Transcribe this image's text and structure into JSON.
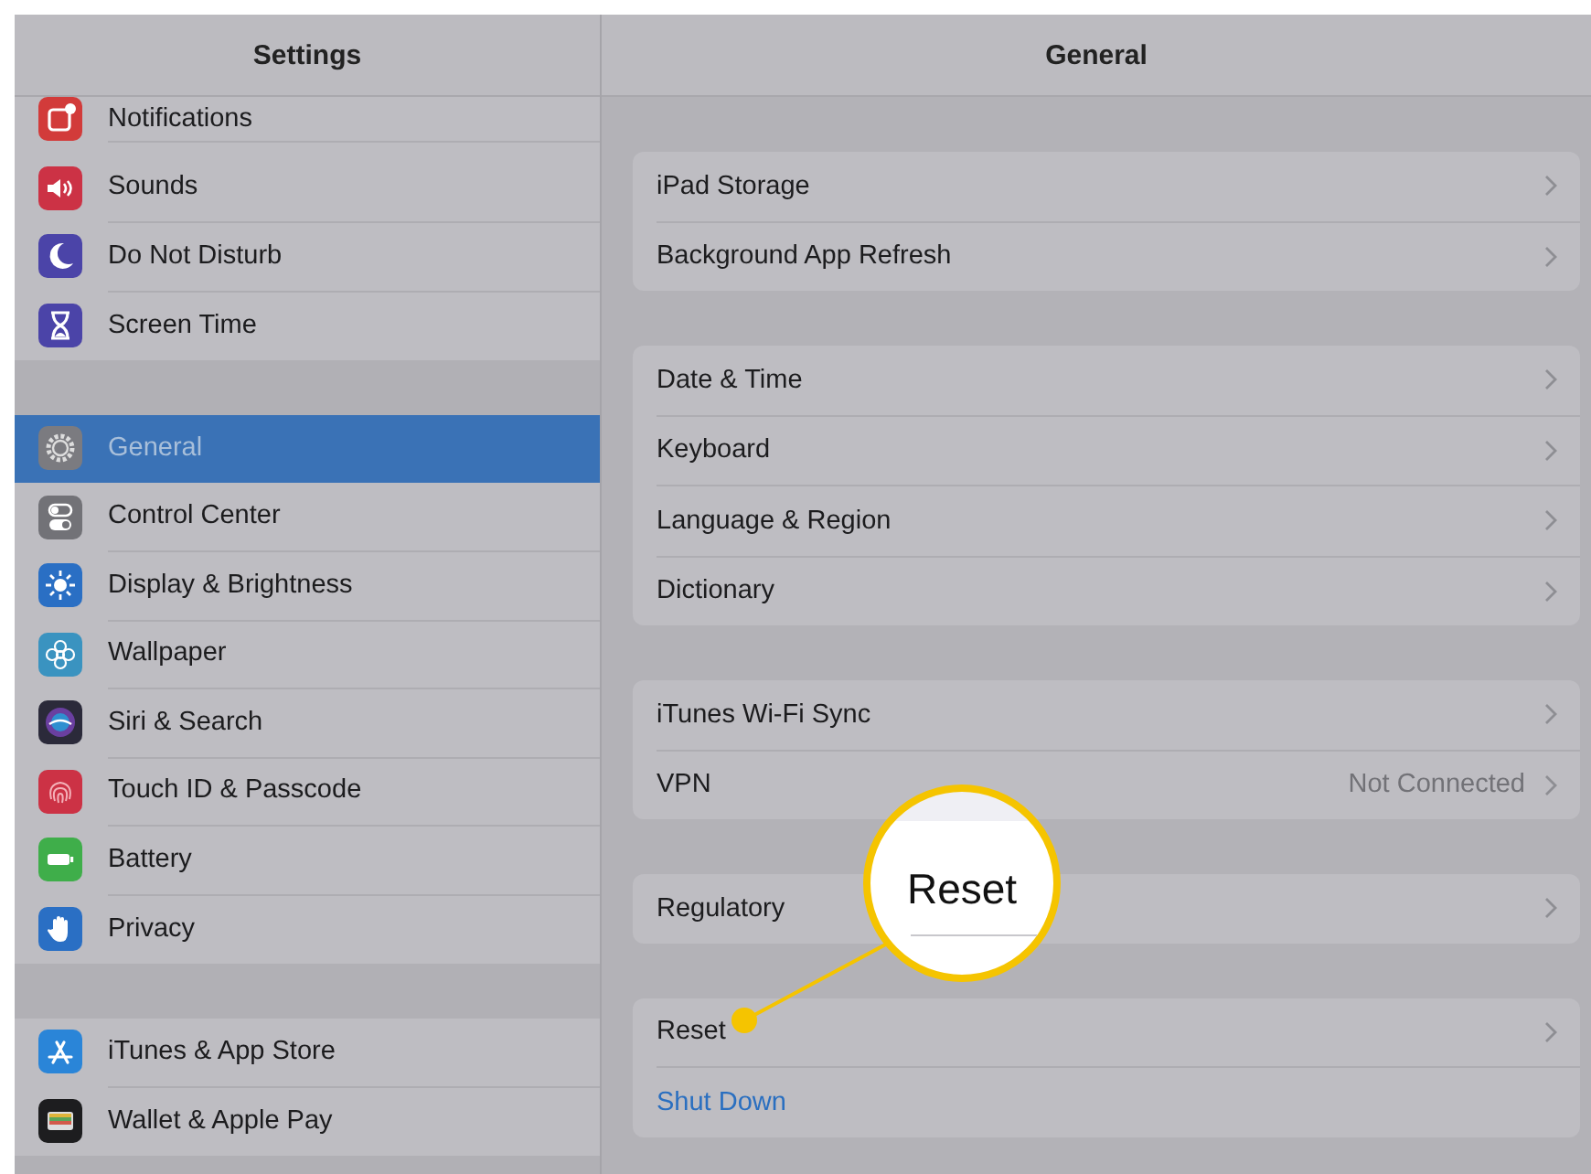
{
  "sidebar": {
    "title": "Settings",
    "groups": [
      {
        "items": [
          {
            "label": "Notifications",
            "selected": false
          },
          {
            "label": "Sounds",
            "selected": false
          },
          {
            "label": "Do Not Disturb",
            "selected": false
          },
          {
            "label": "Screen Time",
            "selected": false
          }
        ]
      },
      {
        "items": [
          {
            "label": "General",
            "selected": true
          },
          {
            "label": "Control Center",
            "selected": false
          },
          {
            "label": "Display & Brightness",
            "selected": false
          },
          {
            "label": "Wallpaper",
            "selected": false
          },
          {
            "label": "Siri & Search",
            "selected": false
          },
          {
            "label": "Touch ID & Passcode",
            "selected": false
          },
          {
            "label": "Battery",
            "selected": false
          },
          {
            "label": "Privacy",
            "selected": false
          }
        ]
      },
      {
        "items": [
          {
            "label": "iTunes & App Store",
            "selected": false
          },
          {
            "label": "Wallet & Apple Pay",
            "selected": false
          }
        ]
      }
    ]
  },
  "detail": {
    "title": "General",
    "groups": [
      {
        "rows": [
          {
            "kind": "nav",
            "label": "iPad Storage"
          },
          {
            "kind": "nav",
            "label": "Background App Refresh"
          }
        ]
      },
      {
        "rows": [
          {
            "kind": "nav",
            "label": "Date & Time"
          },
          {
            "kind": "nav",
            "label": "Keyboard"
          },
          {
            "kind": "nav",
            "label": "Language & Region"
          },
          {
            "kind": "nav",
            "label": "Dictionary"
          }
        ]
      },
      {
        "rows": [
          {
            "kind": "nav",
            "label": "iTunes Wi-Fi Sync"
          },
          {
            "kind": "nav",
            "label": "VPN",
            "value": "Not Connected"
          }
        ]
      },
      {
        "rows": [
          {
            "kind": "nav",
            "label": "Regulatory"
          }
        ]
      },
      {
        "rows": [
          {
            "kind": "nav",
            "label": "Reset"
          },
          {
            "kind": "action",
            "label": "Shut Down"
          }
        ]
      }
    ]
  },
  "callout": {
    "text": "Reset"
  }
}
